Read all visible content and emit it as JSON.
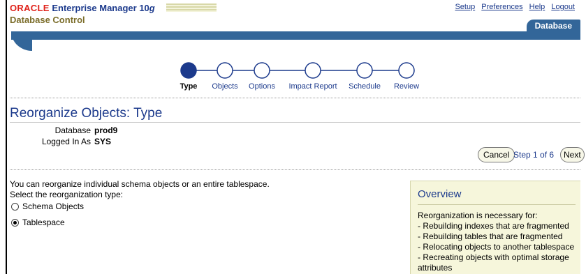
{
  "header": {
    "brand_oracle": "ORACLE",
    "brand_product": "Enterprise Manager 10",
    "brand_version": "g",
    "subtitle": "Database Control",
    "links": [
      "Setup",
      "Preferences",
      "Help",
      "Logout"
    ],
    "active_tab": "Database"
  },
  "train": {
    "steps": [
      "Type",
      "Objects",
      "Options",
      "Impact Report",
      "Schedule",
      "Review"
    ],
    "current_step": "Type"
  },
  "page": {
    "title": "Reorganize Objects: Type",
    "database_label": "Database",
    "database_value": "prod9",
    "logged_in_label": "Logged In As",
    "logged_in_value": "SYS",
    "cancel_button": "Cancel",
    "step_text": "Step 1 of 6",
    "next_button": "Next",
    "intro_text": "You can reorganize individual schema objects or an entire tablespace.",
    "select_label": "Select the reorganization type:",
    "radio_options": [
      {
        "label": "Schema Objects",
        "selected": false
      },
      {
        "label": "Tablespace",
        "selected": true
      }
    ]
  },
  "overview": {
    "title": "Overview",
    "lines": [
      "Reorganization is necessary for:",
      "- Rebuilding indexes that are fragmented",
      "- Rebuilding tables that are fragmented",
      "- Relocating objects to another tablespace",
      "- Recreating objects with optimal storage attributes"
    ]
  },
  "colors": {
    "oracle_red": "#e0231b",
    "link_blue": "#1c3a8c",
    "band_blue": "#336699",
    "overview_bg": "#f6f6db"
  }
}
